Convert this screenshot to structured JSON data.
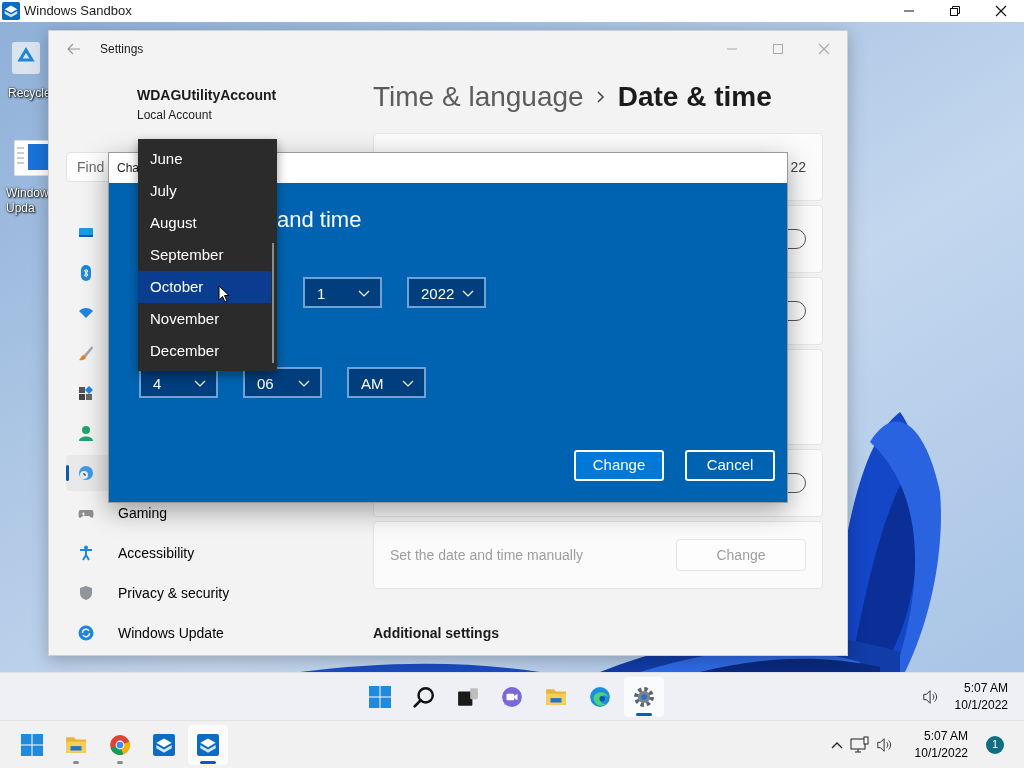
{
  "host_window": {
    "title": "Windows Sandbox"
  },
  "desktop_icons": [
    {
      "lines": [
        "Recycle"
      ]
    },
    {
      "lines": [
        "Window",
        "Upda"
      ]
    }
  ],
  "settings": {
    "title": "Settings",
    "account_name": "WDAGUtilityAccount",
    "account_type": "Local Account",
    "search": {
      "placeholder": "Find"
    },
    "nav": [
      {
        "selected": false
      },
      {
        "selected": false
      },
      {
        "selected": false
      },
      {
        "selected": false
      },
      {
        "selected": false
      },
      {
        "selected": false
      },
      {
        "selected": true
      },
      {
        "label": "Gaming",
        "selected": false
      },
      {
        "label": "Accessibility",
        "selected": false
      },
      {
        "label": "Privacy & security",
        "selected": false
      },
      {
        "label": "Windows Update",
        "selected": false
      }
    ],
    "breadcrumb": {
      "parent": "Time & language",
      "current": "Date & time"
    },
    "cards": [
      {
        "kind": "text",
        "text": "22"
      },
      {
        "kind": "toggle",
        "on": false
      },
      {
        "kind": "toggle",
        "on": false
      },
      {
        "kind": "blank"
      },
      {
        "kind": "toggle",
        "on": false
      },
      {
        "kind": "button",
        "text": "Set the date and time manually",
        "button": "Change",
        "disabled": true
      }
    ],
    "section_heading": "Additional settings"
  },
  "dialog": {
    "title": "Cha",
    "heading": "and time",
    "date_selects": [
      {
        "value": "1"
      },
      {
        "value": "2022"
      }
    ],
    "time_selects": [
      {
        "value": "4"
      },
      {
        "value": "06"
      },
      {
        "value": "AM"
      }
    ],
    "buttons": [
      {
        "label": "Change",
        "default": true
      },
      {
        "label": "Cancel",
        "default": false
      }
    ]
  },
  "month_list": [
    {
      "label": "June",
      "selected": false
    },
    {
      "label": "July",
      "selected": false
    },
    {
      "label": "August",
      "selected": false
    },
    {
      "label": "September",
      "selected": false
    },
    {
      "label": "October",
      "selected": true
    },
    {
      "label": "November",
      "selected": false
    },
    {
      "label": "December",
      "selected": false
    }
  ],
  "sandbox_taskbar": {
    "apps": [
      {
        "active": false
      },
      {
        "active": false
      },
      {
        "active": false
      },
      {
        "active": false
      },
      {
        "active": false
      },
      {
        "active": false
      },
      {
        "active": true
      }
    ],
    "time": "5:07 AM",
    "date": "10/1/2022"
  },
  "host_taskbar": {
    "apps": [
      {
        "running": false,
        "active": false
      },
      {
        "running": true,
        "active": false
      },
      {
        "running": true,
        "active": false
      },
      {
        "running": false,
        "active": false
      },
      {
        "running": true,
        "active": true
      }
    ],
    "time": "5:07 AM",
    "date": "10/1/2022",
    "notification_count": "1"
  }
}
